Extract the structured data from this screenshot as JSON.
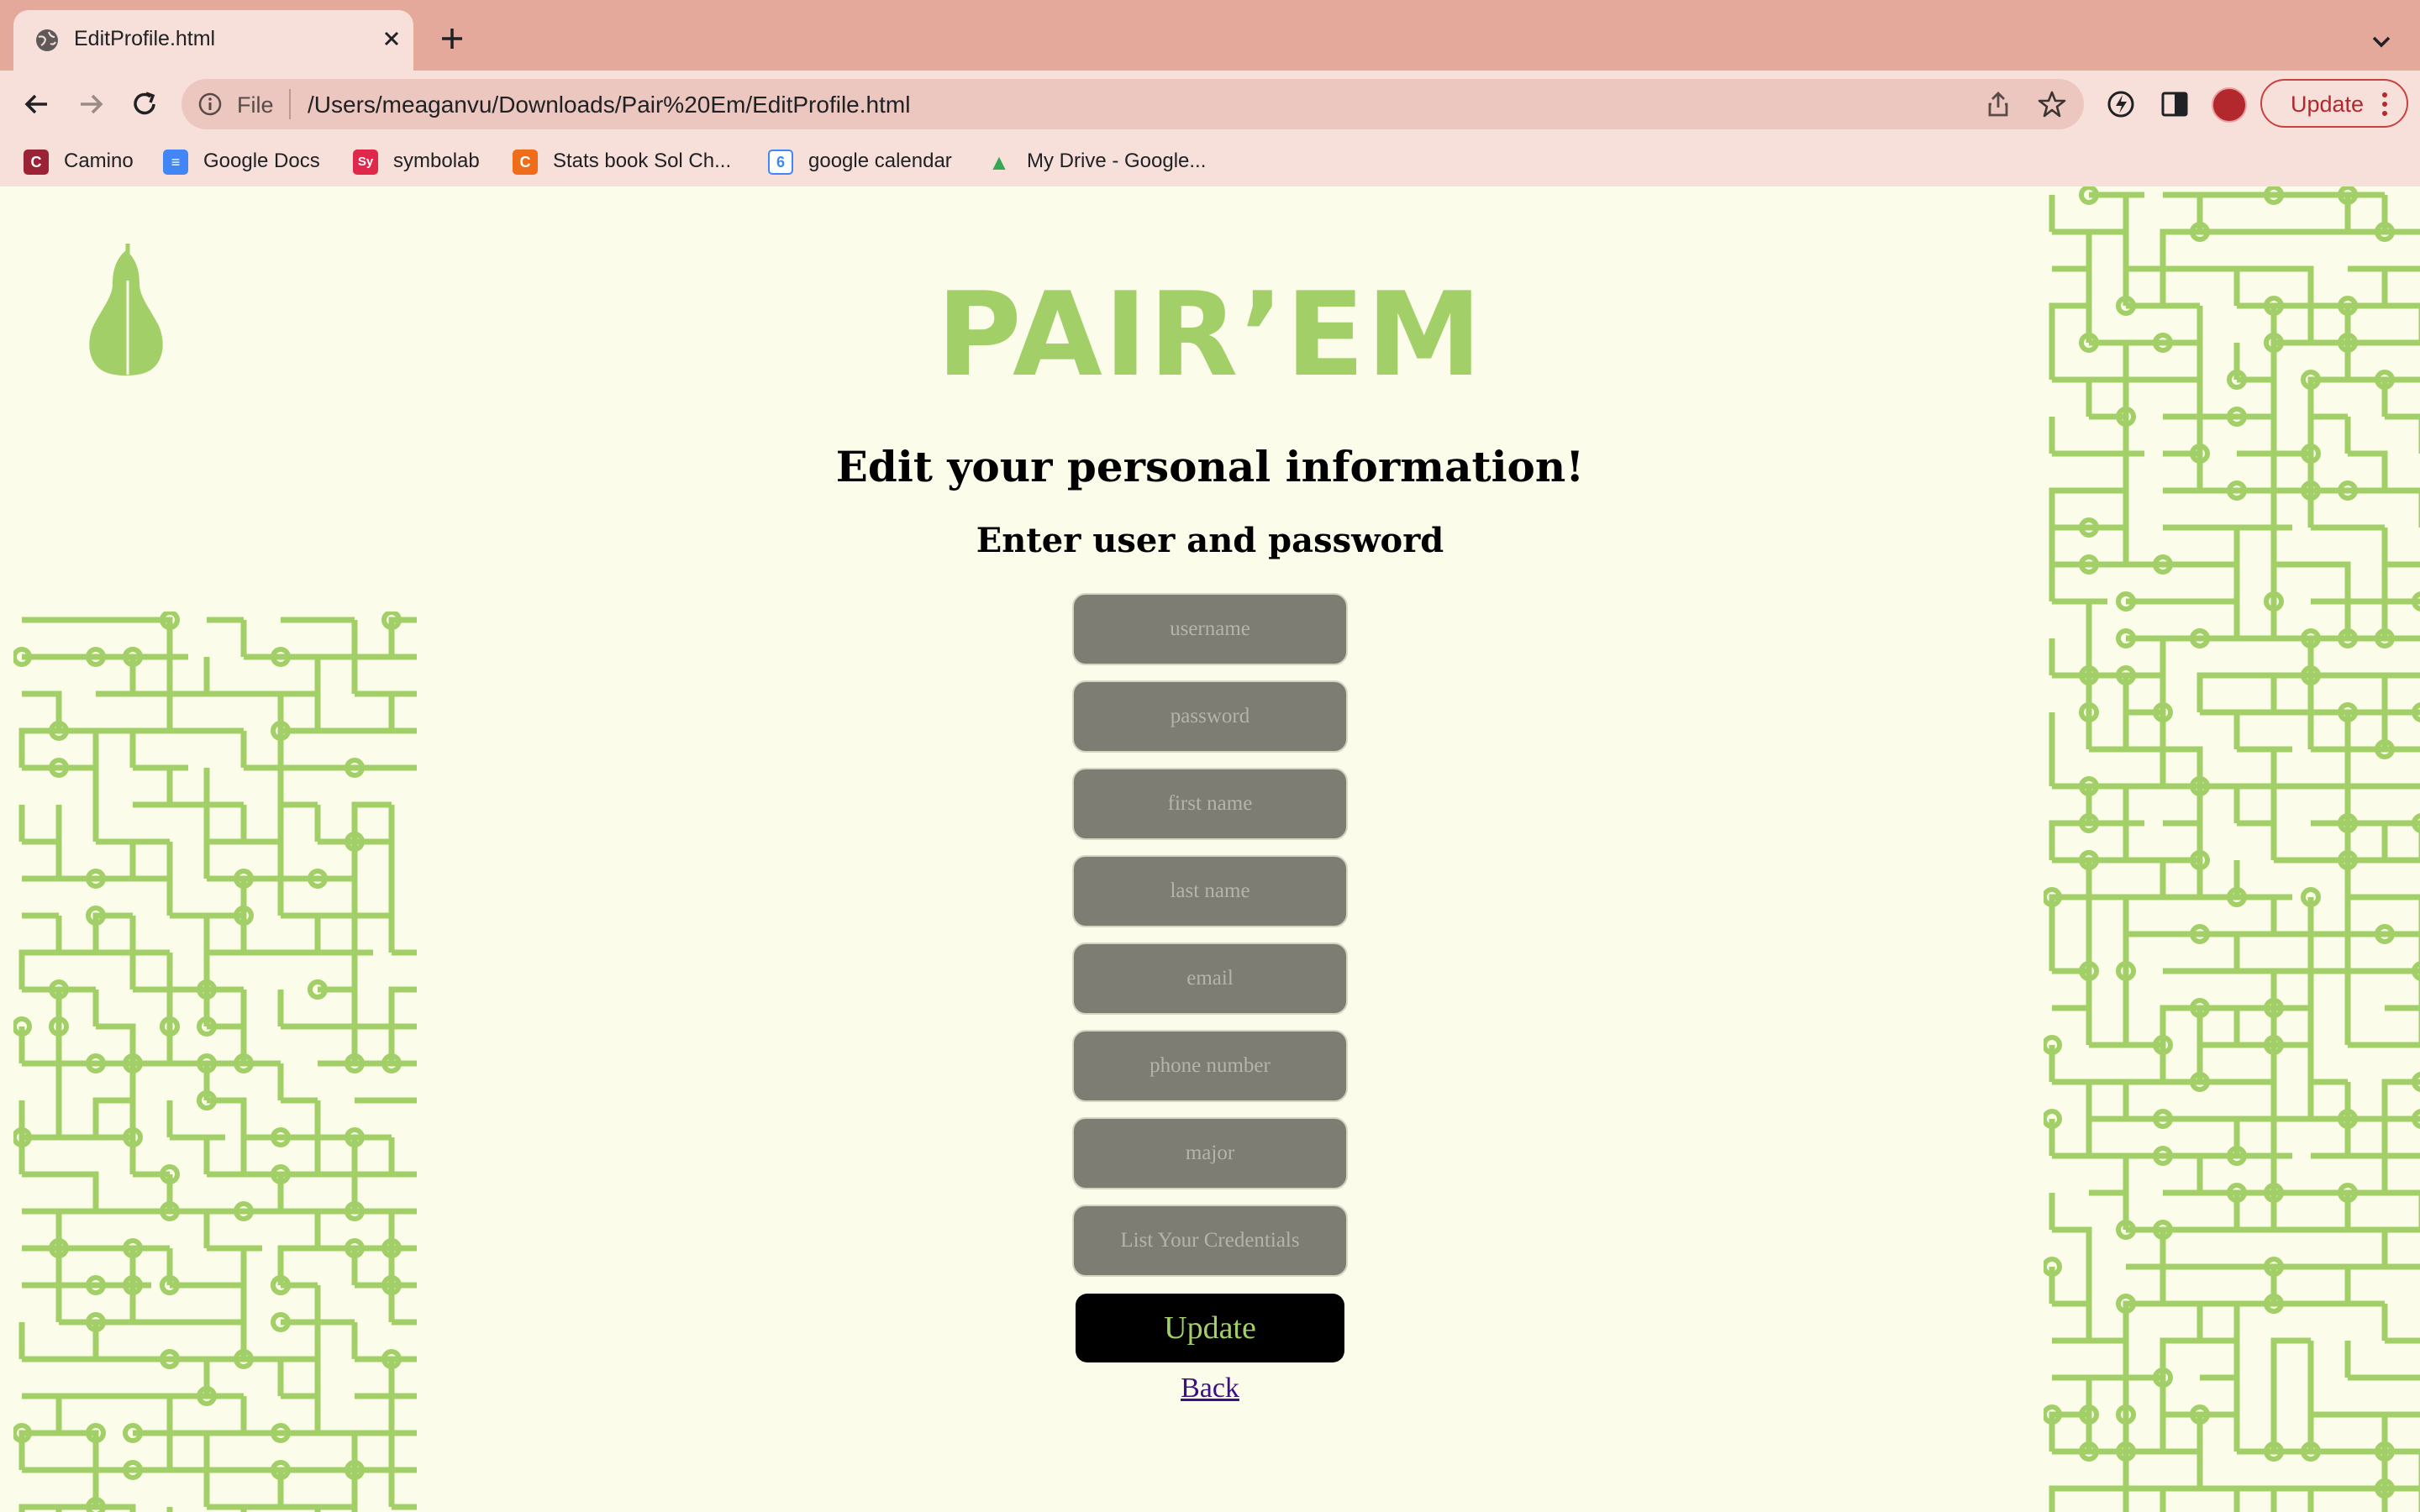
{
  "browser": {
    "tab_title": "EditProfile.html",
    "omnibox": {
      "scheme_label": "File",
      "url": "/Users/meaganvu/Downloads/Pair%20Em/EditProfile.html"
    },
    "update_label": "Update",
    "bookmarks": [
      {
        "label": "Camino",
        "icon": "C",
        "color": "#9b2335"
      },
      {
        "label": "Google Docs",
        "icon": "≡",
        "color": "#4285f4"
      },
      {
        "label": "symbolab",
        "icon": "Sy",
        "color": "#e0284a"
      },
      {
        "label": "Stats book Sol Ch...",
        "icon": "C",
        "color": "#ef6c1a"
      },
      {
        "label": "google calendar",
        "icon": "6",
        "color": "#4285f4"
      },
      {
        "label": "My Drive - Google...",
        "icon": "▲",
        "color": "#34a853"
      }
    ]
  },
  "page": {
    "logo": "PAIR’EM",
    "heading": "Edit your personal information!",
    "subheading": "Enter user and password",
    "fields": [
      {
        "name": "username-input",
        "placeholder": "username",
        "value": ""
      },
      {
        "name": "password-input",
        "placeholder": "password",
        "value": ""
      },
      {
        "name": "first-name-input",
        "placeholder": "first name",
        "value": ""
      },
      {
        "name": "last-name-input",
        "placeholder": "last name",
        "value": ""
      },
      {
        "name": "email-input",
        "placeholder": "email",
        "value": ""
      },
      {
        "name": "phone-number-input",
        "placeholder": "phone number",
        "value": ""
      },
      {
        "name": "major-input",
        "placeholder": "major",
        "value": ""
      },
      {
        "name": "credentials-input",
        "placeholder": "List Your Credentials",
        "value": ""
      }
    ],
    "submit_label": "Update",
    "back_label": "Back"
  },
  "colors": {
    "accent_green": "#a3cf68",
    "page_bg": "#fbfcea",
    "field_bg": "#7d7d73",
    "chrome_tab": "#e4a99b"
  }
}
